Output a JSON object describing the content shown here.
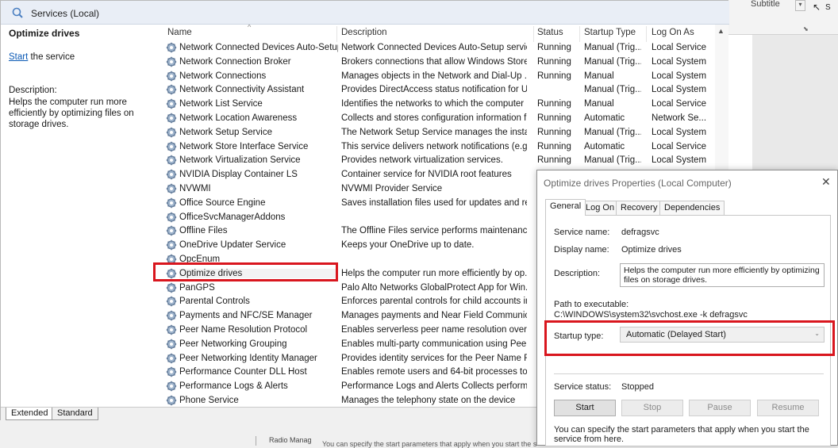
{
  "background_app": {
    "subtitle_label": "Subtitle",
    "pointer_label": "S"
  },
  "window": {
    "title": "Services (Local)"
  },
  "left_pane": {
    "title": "Optimize drives",
    "start_link": "Start",
    "start_suffix": " the service",
    "description_header": "Description:",
    "description": "Helps the computer run more efficiently by optimizing files on storage drives."
  },
  "grid": {
    "columns": {
      "name": "Name",
      "description": "Description",
      "status": "Status",
      "startup_type": "Startup Type",
      "log_on_as": "Log On As"
    },
    "rows": [
      {
        "name": "Network Connected Devices Auto-Setup",
        "description": "Network Connected Devices Auto-Setup servic...",
        "status": "Running",
        "startup_type": "Manual (Trig...",
        "log_on_as": "Local Service"
      },
      {
        "name": "Network Connection Broker",
        "description": "Brokers connections that allow Windows Store ...",
        "status": "Running",
        "startup_type": "Manual (Trig...",
        "log_on_as": "Local System"
      },
      {
        "name": "Network Connections",
        "description": "Manages objects in the Network and Dial-Up ...",
        "status": "Running",
        "startup_type": "Manual",
        "log_on_as": "Local System"
      },
      {
        "name": "Network Connectivity Assistant",
        "description": "Provides DirectAccess status notification for UI ...",
        "status": "",
        "startup_type": "Manual (Trig...",
        "log_on_as": "Local System"
      },
      {
        "name": "Network List Service",
        "description": "Identifies the networks to which the computer ...",
        "status": "Running",
        "startup_type": "Manual",
        "log_on_as": "Local Service"
      },
      {
        "name": "Network Location Awareness",
        "description": "Collects and stores configuration information f...",
        "status": "Running",
        "startup_type": "Automatic",
        "log_on_as": "Network Se..."
      },
      {
        "name": "Network Setup Service",
        "description": "The Network Setup Service manages the install...",
        "status": "Running",
        "startup_type": "Manual (Trig...",
        "log_on_as": "Local System"
      },
      {
        "name": "Network Store Interface Service",
        "description": "This service delivers network notifications (e.g. ...",
        "status": "Running",
        "startup_type": "Automatic",
        "log_on_as": "Local Service"
      },
      {
        "name": "Network Virtualization Service",
        "description": "Provides network virtualization services.",
        "status": "Running",
        "startup_type": "Manual (Trig...",
        "log_on_as": "Local System"
      },
      {
        "name": "NVIDIA Display Container LS",
        "description": "Container service for NVIDIA root features",
        "status": "",
        "startup_type": "",
        "log_on_as": ""
      },
      {
        "name": "NVWMI",
        "description": "NVWMI Provider Service",
        "status": "",
        "startup_type": "",
        "log_on_as": ""
      },
      {
        "name": "Office  Source Engine",
        "description": "Saves installation files used for updates and re...",
        "status": "",
        "startup_type": "",
        "log_on_as": ""
      },
      {
        "name": "OfficeSvcManagerAddons",
        "description": "",
        "status": "",
        "startup_type": "",
        "log_on_as": ""
      },
      {
        "name": "Offline Files",
        "description": "The Offline Files service performs maintenance...",
        "status": "",
        "startup_type": "",
        "log_on_as": ""
      },
      {
        "name": "OneDrive Updater Service",
        "description": "Keeps your OneDrive up to date.",
        "status": "",
        "startup_type": "",
        "log_on_as": ""
      },
      {
        "name": "OpcEnum",
        "description": "",
        "status": "",
        "startup_type": "",
        "log_on_as": ""
      },
      {
        "name": "Optimize drives",
        "description": "Helps the computer run more efficiently by op...",
        "status": "",
        "startup_type": "",
        "log_on_as": ""
      },
      {
        "name": "PanGPS",
        "description": "Palo Alto Networks GlobalProtect App for Win...",
        "status": "",
        "startup_type": "",
        "log_on_as": ""
      },
      {
        "name": "Parental Controls",
        "description": "Enforces parental controls for child accounts in...",
        "status": "",
        "startup_type": "",
        "log_on_as": ""
      },
      {
        "name": "Payments and NFC/SE Manager",
        "description": "Manages payments and Near Field Communic...",
        "status": "",
        "startup_type": "",
        "log_on_as": ""
      },
      {
        "name": "Peer Name Resolution Protocol",
        "description": "Enables serverless peer name resolution over t...",
        "status": "",
        "startup_type": "",
        "log_on_as": ""
      },
      {
        "name": "Peer Networking Grouping",
        "description": "Enables multi-party communication using Peer...",
        "status": "",
        "startup_type": "",
        "log_on_as": ""
      },
      {
        "name": "Peer Networking Identity Manager",
        "description": "Provides identity services for the Peer Name Re...",
        "status": "",
        "startup_type": "",
        "log_on_as": ""
      },
      {
        "name": "Performance Counter DLL Host",
        "description": "Enables remote users and 64-bit processes to ...",
        "status": "",
        "startup_type": "",
        "log_on_as": ""
      },
      {
        "name": "Performance Logs & Alerts",
        "description": "Performance Logs and Alerts Collects performa...",
        "status": "",
        "startup_type": "",
        "log_on_as": ""
      },
      {
        "name": "Phone Service",
        "description": "Manages the telephony state on the device",
        "status": "",
        "startup_type": "",
        "log_on_as": ""
      }
    ]
  },
  "tabs": {
    "extended": "Extended",
    "standard": "Standard"
  },
  "dialog": {
    "title": "Optimize drives Properties (Local Computer)",
    "close": "✕",
    "tabs": [
      "General",
      "Log On",
      "Recovery",
      "Dependencies"
    ],
    "service_name_label": "Service name:",
    "service_name": "defragsvc",
    "display_name_label": "Display name:",
    "display_name": "Optimize drives",
    "description_label": "Description:",
    "description": "Helps the computer run more efficiently by optimizing files on storage drives.",
    "path_label": "Path to executable:",
    "path": "C:\\WINDOWS\\system32\\svchost.exe -k defragsvc",
    "startup_type_label": "Startup type:",
    "startup_type": "Automatic (Delayed Start)",
    "service_status_label": "Service status:",
    "service_status": "Stopped",
    "buttons": {
      "start": "Start",
      "stop": "Stop",
      "pause": "Pause",
      "resume": "Resume"
    },
    "hint": "You can specify the start parameters that apply when you start the service from here."
  },
  "bottom_strip": {
    "item": "Radio Manag",
    "text": "You can specify the start parameters that apply when you start the service"
  },
  "colors": {
    "highlight_red": "#d9161e",
    "link_blue": "#0b59b5"
  }
}
